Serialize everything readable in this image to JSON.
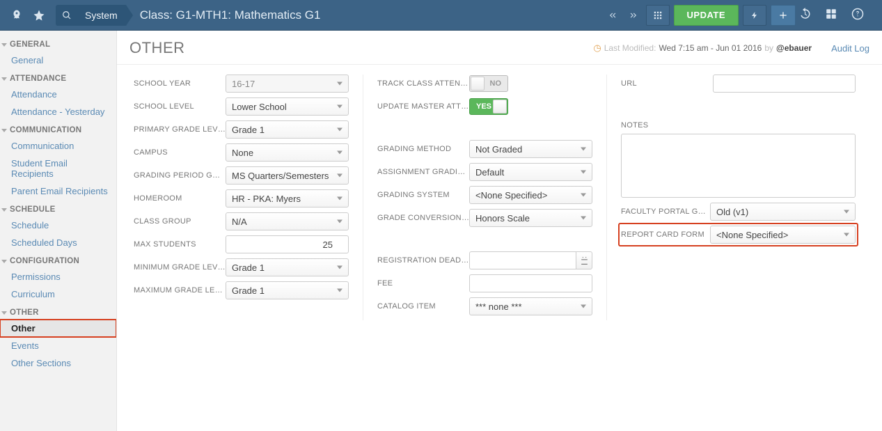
{
  "topbar": {
    "system_label": "System",
    "page_crumb": "Class: G1-MTH1: Mathematics G1",
    "update_label": "UPDATE"
  },
  "sidebar": [
    {
      "head": "GENERAL",
      "items": [
        {
          "label": "General"
        }
      ]
    },
    {
      "head": "ATTENDANCE",
      "items": [
        {
          "label": "Attendance"
        },
        {
          "label": "Attendance - Yesterday"
        }
      ]
    },
    {
      "head": "COMMUNICATION",
      "items": [
        {
          "label": "Communication"
        },
        {
          "label": "Student Email Recipients"
        },
        {
          "label": "Parent Email Recipients"
        }
      ]
    },
    {
      "head": "SCHEDULE",
      "items": [
        {
          "label": "Schedule"
        },
        {
          "label": "Scheduled Days"
        }
      ]
    },
    {
      "head": "CONFIGURATION",
      "items": [
        {
          "label": "Permissions"
        },
        {
          "label": "Curriculum"
        }
      ]
    },
    {
      "head": "OTHER",
      "items": [
        {
          "label": "Other",
          "active": true,
          "boxed": true
        },
        {
          "label": "Events"
        },
        {
          "label": "Other Sections"
        }
      ]
    }
  ],
  "page": {
    "title": "OTHER",
    "last_modified_label": "Last Modified:",
    "last_modified_ts": "Wed 7:15 am - Jun 01 2016",
    "by_label": "by",
    "user": "@ebauer",
    "audit_log": "Audit Log"
  },
  "col1": {
    "school_year": {
      "label": "SCHOOL YEAR",
      "value": "16-17",
      "disabled": true
    },
    "school_level": {
      "label": "SCHOOL LEVEL",
      "value": "Lower School"
    },
    "primary_grade": {
      "label": "PRIMARY GRADE LEVEL",
      "value": "Grade 1"
    },
    "campus": {
      "label": "CAMPUS",
      "value": "None"
    },
    "grading_period_group": {
      "label": "GRADING PERIOD GROUP",
      "value": "MS Quarters/Semesters"
    },
    "homeroom": {
      "label": "HOMEROOM",
      "value": "HR - PKA: Myers"
    },
    "class_group": {
      "label": "CLASS GROUP",
      "value": "N/A"
    },
    "max_students": {
      "label": "MAX STUDENTS",
      "value": "25"
    },
    "min_grade": {
      "label": "MINIMUM GRADE LEVEL",
      "value": "Grade 1"
    },
    "max_grade": {
      "label": "MAXIMUM GRADE LEVEL",
      "value": "Grade 1"
    }
  },
  "col2": {
    "track_attendance": {
      "label": "TRACK CLASS ATTENDANCE",
      "value": "NO"
    },
    "update_master": {
      "label": "UPDATE MASTER ATTEND…",
      "value": "YES"
    },
    "grading_method": {
      "label": "GRADING METHOD",
      "value": "Not Graded"
    },
    "assignment_grading": {
      "label": "ASSIGNMENT GRADING M…",
      "value": "Default"
    },
    "grading_system": {
      "label": "GRADING SYSTEM",
      "value": "<None Specified>"
    },
    "conversion_scale": {
      "label": "GRADE CONVERSION SCALE",
      "value": "Honors Scale"
    },
    "reg_deadline": {
      "label": "REGISTRATION DEADLINE",
      "value": ""
    },
    "fee": {
      "label": "FEE",
      "value": ""
    },
    "catalog_item": {
      "label": "CATALOG ITEM",
      "value": "*** none ***"
    }
  },
  "col3": {
    "url": {
      "label": "URL",
      "value": ""
    },
    "notes": {
      "label": "NOTES",
      "value": ""
    },
    "faculty_portal": {
      "label": "FACULTY PORTAL GRADE…",
      "value": "Old (v1)"
    },
    "report_card": {
      "label": "REPORT CARD FORM",
      "value": "<None Specified>"
    }
  }
}
